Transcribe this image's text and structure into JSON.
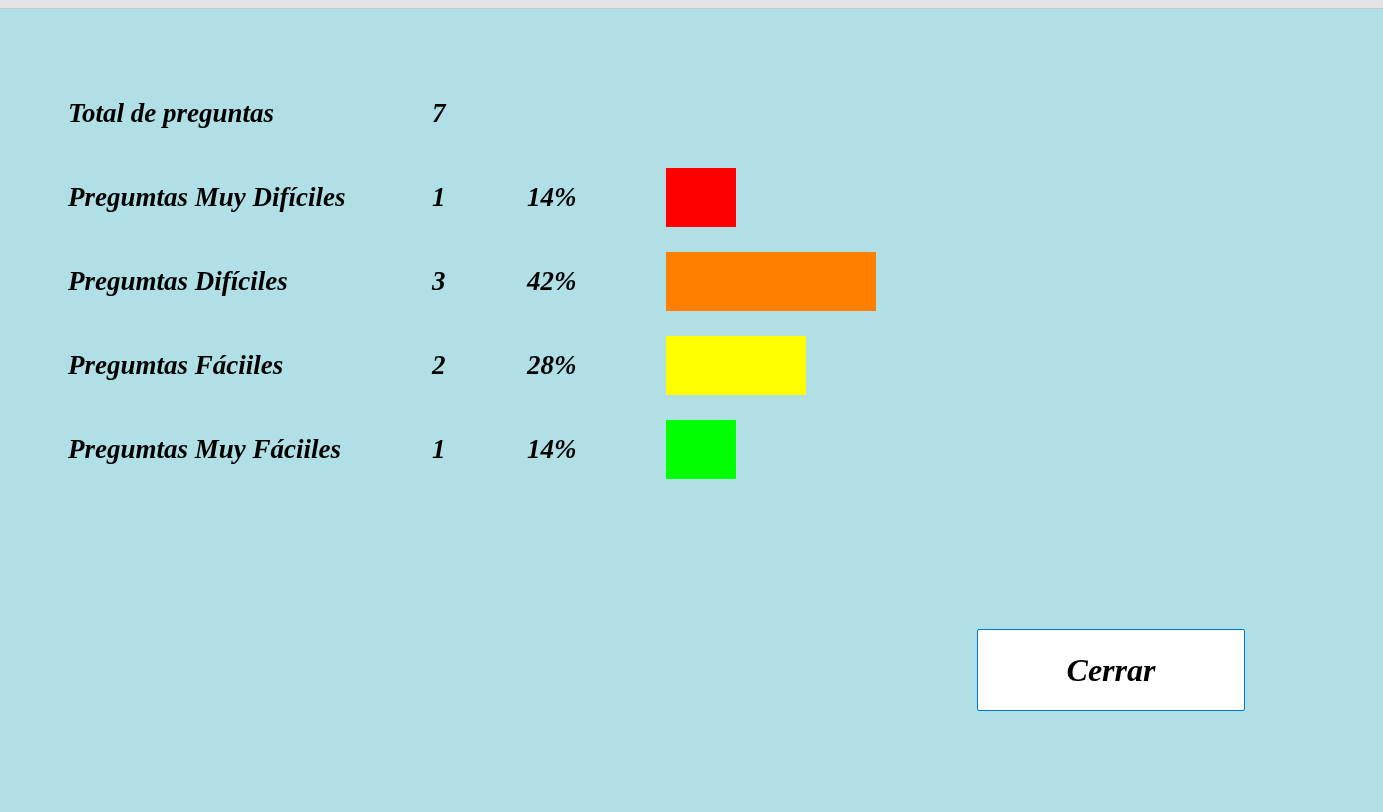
{
  "total": {
    "label": "Total de preguntas",
    "count": "7"
  },
  "categories": [
    {
      "label": "Pregumtas Muy Difíciles",
      "count": "1",
      "percent": "14%",
      "color": "#ff0000"
    },
    {
      "label": "Pregumtas Difíciles",
      "count": "3",
      "percent": "42%",
      "color": "#ff8000"
    },
    {
      "label": "Pregumtas Fáciiles",
      "count": "2",
      "percent": "28%",
      "color": "#ffff00"
    },
    {
      "label": "Pregumtas Muy Fáciiles",
      "count": "1",
      "percent": "14%",
      "color": "#00ff00"
    }
  ],
  "buttons": [
    "Cerrar"
  ]
}
